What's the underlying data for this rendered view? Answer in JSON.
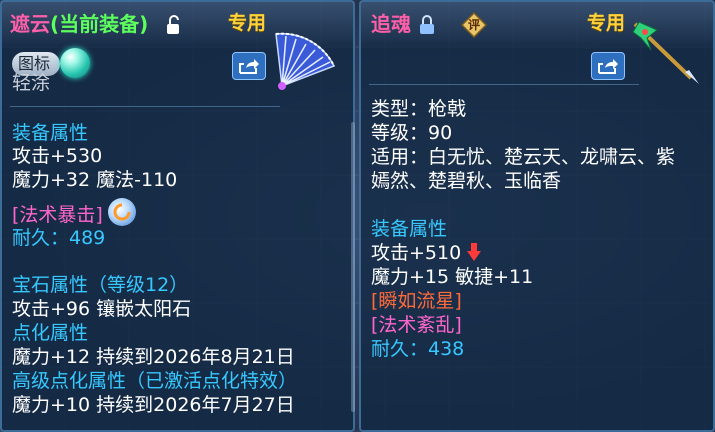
{
  "left": {
    "title_name": "遮云",
    "title_status": "(当前装备)",
    "zhuanyong": "专用",
    "tag_label": "图标",
    "subtitle": "轻涂",
    "section_attr": "装备属性",
    "attrs": [
      "攻击+530",
      "魔力+32 魔法-110"
    ],
    "skill": "[法术暴击]",
    "durability": "耐久：489",
    "section_gem": "宝石属性（等级12）",
    "gem_line": "攻击+96 镶嵌太阳石",
    "section_refine": "点化属性",
    "refine_line": "魔力+12 持续到2026年8月21日",
    "section_adv_refine": "高级点化属性（已激活点化特效）",
    "adv_refine_line": "魔力+10 持续到2026年7月27日"
  },
  "right": {
    "title_name": "追魂",
    "rating_label": "评",
    "zhuanyong": "专用",
    "type_line": "类型：枪戟",
    "level_line": "等级：90",
    "suits_line1": "适用：白无忧、楚云天、龙啸云、紫",
    "suits_line2": "嫣然、楚碧秋、玉临香",
    "section_attr": "装备属性",
    "attack": "攻击+510",
    "attr_line2": "魔力+15 敏捷+11",
    "special": "[瞬如流星]",
    "skill": "[法术紊乱]",
    "durability": "耐久：438"
  },
  "colors": {
    "pink": "#ff5fa8",
    "green": "#5cff5c",
    "gold": "#ffd23a",
    "cyan": "#36c8ff",
    "magenta": "#ff66cc",
    "orange": "#ff6a3a"
  },
  "icons": [
    "unlock-icon",
    "lock-icon",
    "share-icon",
    "fan-weapon-icon",
    "spear-weapon-icon",
    "down-arrow-icon",
    "skill-icon",
    "orb-icon",
    "rating-icon"
  ]
}
